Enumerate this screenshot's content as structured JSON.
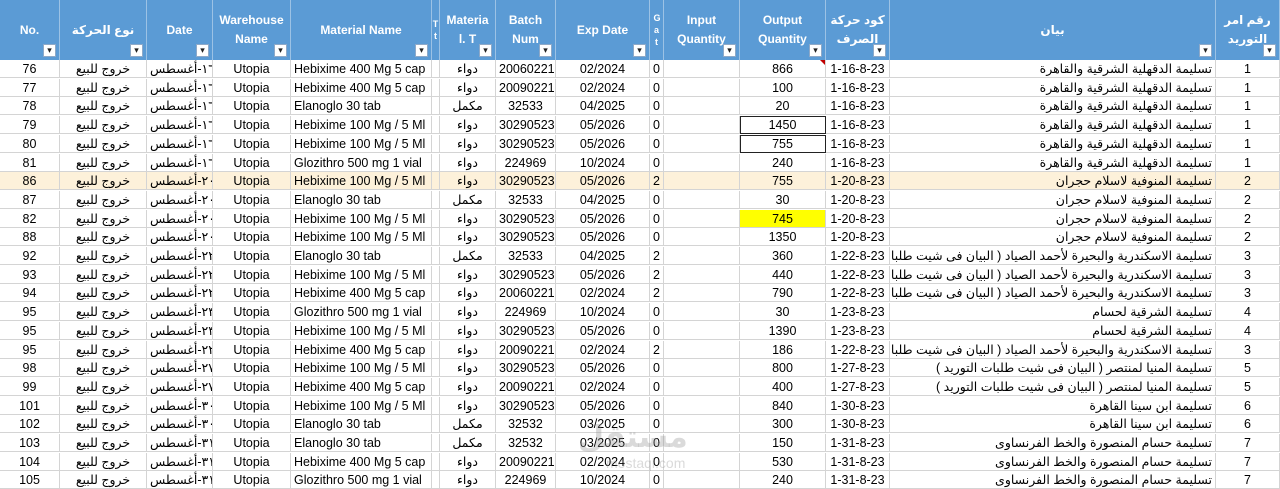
{
  "headers": {
    "no": "No.",
    "move_type": "نوع الحركة",
    "date": "Date",
    "warehouse": "Warehouse Name",
    "material": "Material Name",
    "narrow1": "T t",
    "mat_type": "Materia l. T",
    "batch": "Batch Num",
    "exp": "Exp Date",
    "narrow2": "G a t",
    "input_qty": "Input Quantity",
    "output_qty": "Output Quantity",
    "code": "كود حركة الصرف",
    "statement": "بيان",
    "order_no": "رقم امر التوريد"
  },
  "filter_glyphs": {
    "dropdown": "▾",
    "sorted": "↓",
    "filtered": "▾"
  },
  "rows": [
    {
      "no": "76",
      "move": "خروج للبيع",
      "date": "١٦-أغسطس",
      "wh": "Utopia",
      "mat": "Hebiximе 400 Mg 5 cap",
      "mtype": "دواء",
      "batch": "20060221",
      "exp": "02/2024",
      "g": "0",
      "inq": "",
      "outq": "866",
      "code": "1-16-8-23",
      "stmt": "تسليمة الدقهلية الشرقية والقاهرة",
      "order": "1"
    },
    {
      "no": "77",
      "move": "خروج للبيع",
      "date": "١٦-أغسطس",
      "wh": "Utopia",
      "mat": "Hebiximе 400 Mg 5 cap",
      "mtype": "دواء",
      "batch": "20090221",
      "exp": "02/2024",
      "g": "0",
      "inq": "",
      "outq": "100",
      "code": "1-16-8-23",
      "stmt": "تسليمة الدقهلية الشرقية والقاهرة",
      "order": "1"
    },
    {
      "no": "78",
      "move": "خروج للبيع",
      "date": "١٦-أغسطس",
      "wh": "Utopia",
      "mat": "Elanoglo 30 tab",
      "mtype": "مكمل",
      "batch": "32533",
      "exp": "04/2025",
      "g": "0",
      "inq": "",
      "outq": "20",
      "code": "1-16-8-23",
      "stmt": "تسليمة الدقهلية الشرقية والقاهرة",
      "order": "1"
    },
    {
      "no": "79",
      "move": "خروج للبيع",
      "date": "١٦-أغسطس",
      "wh": "Utopia",
      "mat": "Hebiximе 100 Mg / 5 Ml",
      "mtype": "دواء",
      "batch": "30290523",
      "exp": "05/2026",
      "g": "0",
      "inq": "",
      "outq": "1450",
      "code": "1-16-8-23",
      "stmt": "تسليمة الدقهلية الشرقية والقاهرة",
      "order": "1"
    },
    {
      "no": "80",
      "move": "خروج للبيع",
      "date": "١٦-أغسطس",
      "wh": "Utopia",
      "mat": "Hebiximе 100 Mg / 5 Ml",
      "mtype": "دواء",
      "batch": "30290523",
      "exp": "05/2026",
      "g": "0",
      "inq": "",
      "outq": "755",
      "code": "1-16-8-23",
      "stmt": "تسليمة الدقهلية الشرقية والقاهرة",
      "order": "1"
    },
    {
      "no": "81",
      "move": "خروج للبيع",
      "date": "١٦-أغسطس",
      "wh": "Utopia",
      "mat": "Glozithro 500 mg 1 vial",
      "mtype": "دواء",
      "batch": "224969",
      "exp": "10/2024",
      "g": "0",
      "inq": "",
      "outq": "240",
      "code": "1-16-8-23",
      "stmt": "تسليمة الدقهلية الشرقية والقاهرة",
      "order": "1"
    },
    {
      "no": "86",
      "move": "خروج للبيع",
      "date": "٢٠-أغسطس",
      "wh": "Utopia",
      "mat": "Hebiximе 100 Mg / 5 Ml",
      "mtype": "دواء",
      "batch": "30290523",
      "exp": "05/2026",
      "g": "2",
      "inq": "",
      "outq": "755",
      "code": "1-20-8-23",
      "stmt": "تسليمة المنوفية لاسلام حجران",
      "order": "2"
    },
    {
      "no": "87",
      "move": "خروج للبيع",
      "date": "٢٠-أغسطس",
      "wh": "Utopia",
      "mat": "Elanoglo 30 tab",
      "mtype": "مكمل",
      "batch": "32533",
      "exp": "04/2025",
      "g": "0",
      "inq": "",
      "outq": "30",
      "code": "1-20-8-23",
      "stmt": "تسليمة المنوفية لاسلام حجران",
      "order": "2"
    },
    {
      "no": "82",
      "move": "خروج للبيع",
      "date": "٢٠-أغسطس",
      "wh": "Utopia",
      "mat": "Hebiximе 100 Mg / 5 Ml",
      "mtype": "دواء",
      "batch": "30290523",
      "exp": "05/2026",
      "g": "0",
      "inq": "",
      "outq": "745",
      "code": "1-20-8-23",
      "stmt": "تسليمة المنوفية لاسلام حجران",
      "order": "2"
    },
    {
      "no": "88",
      "move": "خروج للبيع",
      "date": "٢٠-أغسطس",
      "wh": "Utopia",
      "mat": "Hebiximе 100 Mg / 5 Ml",
      "mtype": "دواء",
      "batch": "30290523",
      "exp": "05/2026",
      "g": "0",
      "inq": "",
      "outq": "1350",
      "code": "1-20-8-23",
      "stmt": "تسليمة المنوفية لاسلام حجران",
      "order": "2"
    },
    {
      "no": "92",
      "move": "خروج للبيع",
      "date": "٢٢-أغسطس",
      "wh": "Utopia",
      "mat": "Elanoglo 30 tab",
      "mtype": "مكمل",
      "batch": "32533",
      "exp": "04/2025",
      "g": "2",
      "inq": "",
      "outq": "360",
      "code": "1-22-8-23",
      "stmt": "تسليمة الاسكندرية والبحيرة لأحمد الصياد ( البيان فى شيت طلبات التوريد",
      "order": "3"
    },
    {
      "no": "93",
      "move": "خروج للبيع",
      "date": "٢٢-أغسطس",
      "wh": "Utopia",
      "mat": "Hebiximе 100 Mg / 5 Ml",
      "mtype": "دواء",
      "batch": "30290523",
      "exp": "05/2026",
      "g": "2",
      "inq": "",
      "outq": "440",
      "code": "1-22-8-23",
      "stmt": "تسليمة الاسكندرية والبحيرة لأحمد الصياد ( البيان فى شيت طلبات التوريد",
      "order": "3"
    },
    {
      "no": "94",
      "move": "خروج للبيع",
      "date": "٢٢-أغسطس",
      "wh": "Utopia",
      "mat": "Hebiximе 400 Mg 5 cap",
      "mtype": "دواء",
      "batch": "20060221",
      "exp": "02/2024",
      "g": "2",
      "inq": "",
      "outq": "790",
      "code": "1-22-8-23",
      "stmt": "تسليمة الاسكندرية والبحيرة لأحمد الصياد ( البيان فى شيت طلبات التوريد",
      "order": "3"
    },
    {
      "no": "95",
      "move": "خروج للبيع",
      "date": "٢٣-أغسطس",
      "wh": "Utopia",
      "mat": "Glozithro 500 mg 1 vial",
      "mtype": "دواء",
      "batch": "224969",
      "exp": "10/2024",
      "g": "0",
      "inq": "",
      "outq": "30",
      "code": "1-23-8-23",
      "stmt": "تسليمة الشرقية لحسام",
      "order": "4"
    },
    {
      "no": "95",
      "move": "خروج للبيع",
      "date": "٢٣-أغسطس",
      "wh": "Utopia",
      "mat": "Hebiximе 100 Mg / 5 Ml",
      "mtype": "دواء",
      "batch": "30290523",
      "exp": "05/2026",
      "g": "0",
      "inq": "",
      "outq": "1390",
      "code": "1-23-8-23",
      "stmt": "تسليمة الشرقية لحسام",
      "order": "4"
    },
    {
      "no": "95",
      "move": "خروج للبيع",
      "date": "٢٢-أغسطس",
      "wh": "Utopia",
      "mat": "Hebiximе 400 Mg 5 cap",
      "mtype": "دواء",
      "batch": "20090221",
      "exp": "02/2024",
      "g": "2",
      "inq": "",
      "outq": "186",
      "code": "1-22-8-23",
      "stmt": "تسليمة الاسكندرية والبحيرة لأحمد الصياد ( البيان فى شيت طلبات التوريد",
      "order": "3"
    },
    {
      "no": "98",
      "move": "خروج للبيع",
      "date": "٢٧-أغسطس",
      "wh": "Utopia",
      "mat": "Hebiximе 100 Mg / 5 Ml",
      "mtype": "دواء",
      "batch": "30290523",
      "exp": "05/2026",
      "g": "0",
      "inq": "",
      "outq": "800",
      "code": "1-27-8-23",
      "stmt": "تسليمة المنيا لمنتصر ( البيان فى شيت طلبات التوريد )",
      "order": "5"
    },
    {
      "no": "99",
      "move": "خروج للبيع",
      "date": "٢٧-أغسطس",
      "wh": "Utopia",
      "mat": "Hebiximе 400 Mg 5 cap",
      "mtype": "دواء",
      "batch": "20090221",
      "exp": "02/2024",
      "g": "0",
      "inq": "",
      "outq": "400",
      "code": "1-27-8-23",
      "stmt": "تسليمة المنيا لمنتصر ( البيان فى شيت طلبات التوريد )",
      "order": "5"
    },
    {
      "no": "101",
      "move": "خروج للبيع",
      "date": "٣٠-أغسطس",
      "wh": "Utopia",
      "mat": "Hebiximе 100 Mg / 5 Ml",
      "mtype": "دواء",
      "batch": "30290523",
      "exp": "05/2026",
      "g": "0",
      "inq": "",
      "outq": "840",
      "code": "1-30-8-23",
      "stmt": "تسليمة ابن سينا القاهرة",
      "order": "6"
    },
    {
      "no": "102",
      "move": "خروج للبيع",
      "date": "٣٠-أغسطس",
      "wh": "Utopia",
      "mat": "Elanoglo 30 tab",
      "mtype": "مكمل",
      "batch": "32532",
      "exp": "03/2025",
      "g": "0",
      "inq": "",
      "outq": "300",
      "code": "1-30-8-23",
      "stmt": "تسليمة ابن سينا القاهرة",
      "order": "6"
    },
    {
      "no": "103",
      "move": "خروج للبيع",
      "date": "٣١-أغسطس",
      "wh": "Utopia",
      "mat": "Elanoglo 30 tab",
      "mtype": "مكمل",
      "batch": "32532",
      "exp": "03/2025",
      "g": "0",
      "inq": "",
      "outq": "150",
      "code": "1-31-8-23",
      "stmt": "تسليمة حسام المنصورة والخط الفرنساوى",
      "order": "7"
    },
    {
      "no": "104",
      "move": "خروج للبيع",
      "date": "٣١-أغسطس",
      "wh": "Utopia",
      "mat": "Hebiximе 400 Mg 5 cap",
      "mtype": "دواء",
      "batch": "20090221",
      "exp": "02/2024",
      "g": "0",
      "inq": "",
      "outq": "530",
      "code": "1-31-8-23",
      "stmt": "تسليمة حسام المنصورة والخط الفرنساوى",
      "order": "7"
    },
    {
      "no": "105",
      "move": "خروج للبيع",
      "date": "٣١-أغسطس",
      "wh": "Utopia",
      "mat": "Glozithro 500 mg 1 vial",
      "mtype": "دواء",
      "batch": "224969",
      "exp": "10/2024",
      "g": "0",
      "inq": "",
      "outq": "240",
      "code": "1-31-8-23",
      "stmt": "تسليمة حسام المنصورة والخط الفرنساوى",
      "order": "7"
    }
  ],
  "watermark": {
    "main": "مستقل",
    "sub": "mostaql.com"
  },
  "colors": {
    "header_bg": "#5b9bd5",
    "highlight_row": "#fdf1da",
    "yellow_cell": "#ffff00",
    "comment_mark": "#c00000"
  }
}
